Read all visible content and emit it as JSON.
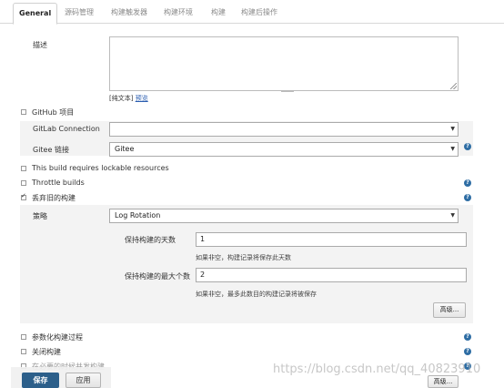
{
  "tabs": [
    "General",
    "源码管理",
    "构建触发器",
    "构建环境",
    "构建",
    "构建后操作"
  ],
  "description": {
    "label": "描述",
    "plain_text": "[纯文本]",
    "preview": "预览"
  },
  "github_project": {
    "label": "GitHub 项目"
  },
  "gitlab_connection": {
    "label": "GitLab Connection",
    "value": ""
  },
  "gitee_link": {
    "label": "Gitee 链接",
    "value": "Gitee"
  },
  "lockable_resources": {
    "label": "This build requires lockable resources"
  },
  "throttle_builds": {
    "label": "Throttle builds"
  },
  "discard_old_builds": {
    "label": "丢弃旧的构建",
    "checked": true
  },
  "strategy": {
    "label": "策略",
    "value": "Log Rotation"
  },
  "keep_days": {
    "label": "保持构建的天数",
    "value": "1",
    "hint": "如果非空，构建记录将保存此天数"
  },
  "keep_max": {
    "label": "保持构建的最大个数",
    "value": "2",
    "hint": "如果非空，最多此数目的构建记录将被保存"
  },
  "advanced_label": "高级...",
  "parameterized": {
    "label": "参数化构建过程"
  },
  "disable_build": {
    "label": "关闭构建"
  },
  "concurrent_build": {
    "label": "在必要的时候并发构建"
  },
  "footer": {
    "save": "保存",
    "apply": "应用",
    "advanced": "高级..."
  },
  "watermark": "https://blog.csdn.net/qq_40823910",
  "colors": {
    "primary": "#2c5f8a",
    "help": "#2e6da4",
    "link": "#2a5db0"
  }
}
